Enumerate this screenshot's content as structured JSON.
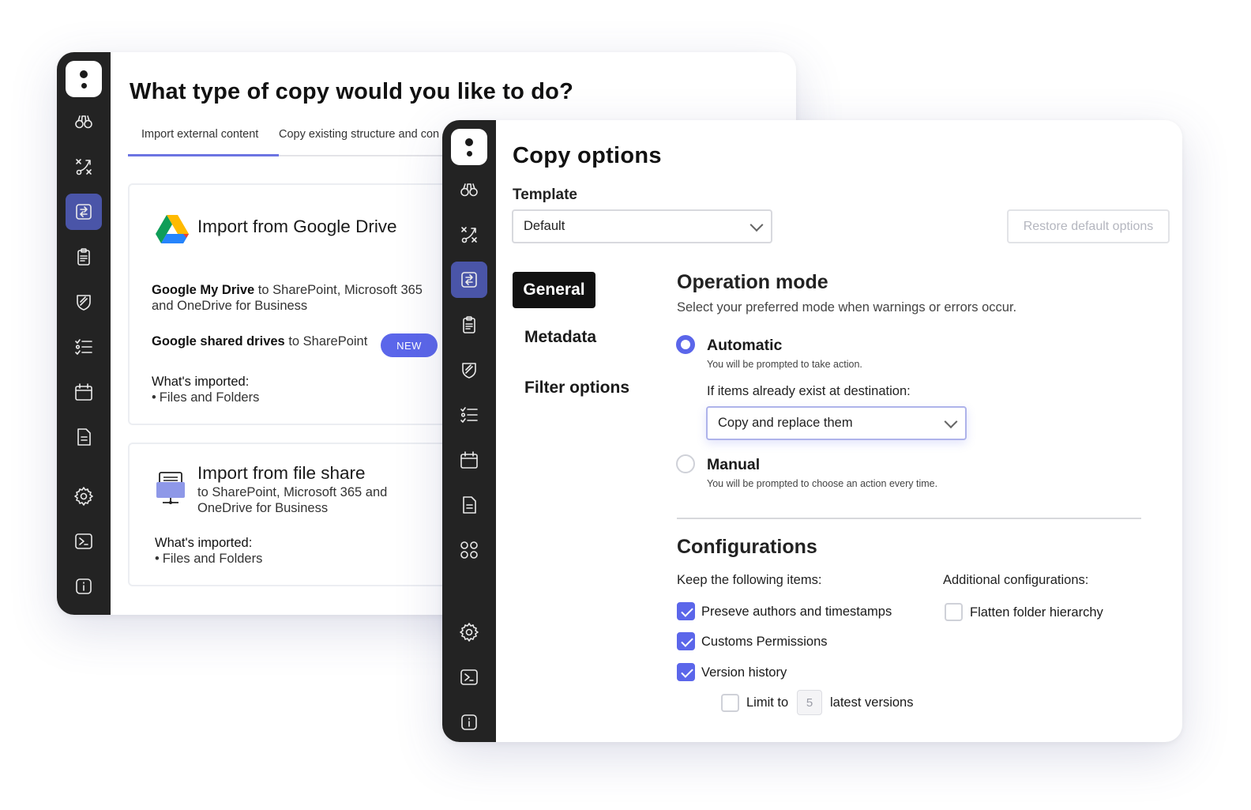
{
  "back_window": {
    "title": "What type of copy would you like to do?",
    "tabs": [
      {
        "label": "Import external content",
        "active": true
      },
      {
        "label": "Copy existing structure and con"
      }
    ],
    "cards": [
      {
        "title": "Import from Google Drive",
        "icon": "google-drive-icon",
        "line1_bold": "Google My Drive",
        "line1_rest": " to SharePoint, Microsoft 365",
        "line1_cont": "and OneDrive for Business",
        "line2_bold": "Google shared drives",
        "line2_rest": " to SharePoint",
        "badge": "NEW",
        "imported_label": "What's imported:",
        "imported_item": "Files and Folders"
      },
      {
        "title": "Import from file share",
        "icon": "file-share-icon",
        "subtitle1": "to SharePoint, Microsoft 365 and",
        "subtitle2": "OneDrive for Business",
        "imported_label": "What's imported:",
        "imported_item": "Files and Folders"
      }
    ]
  },
  "front_window": {
    "title": "Copy options",
    "template_label": "Template",
    "template_value": "Default",
    "restore_button": "Restore default options",
    "nav": [
      "General",
      "Metadata",
      "Filter options"
    ],
    "operation_mode": {
      "title": "Operation mode",
      "subtitle": "Select your preferred mode when warnings or errors occur.",
      "automatic_label": "Automatic",
      "automatic_help": "You will be prompted to take action.",
      "exists_label": "If items already exist at destination:",
      "exists_value": "Copy and replace them",
      "manual_label": "Manual",
      "manual_help": "You will be prompted to choose an action every time."
    },
    "configurations": {
      "title": "Configurations",
      "keep_label": "Keep the following items:",
      "additional_label": "Additional configurations:",
      "keep_items": [
        {
          "label": "Preseve authors and timestamps",
          "checked": true
        },
        {
          "label": "Customs Permissions",
          "checked": true
        },
        {
          "label": "Version history",
          "checked": true
        }
      ],
      "limit_label": "Limit to",
      "limit_value": "5",
      "limit_suffix": "latest versions",
      "flatten_label": "Flatten folder hierarchy"
    }
  },
  "colors": {
    "accent": "#5b66ea",
    "rail": "#232323",
    "rail_active": "#4a55a8"
  }
}
